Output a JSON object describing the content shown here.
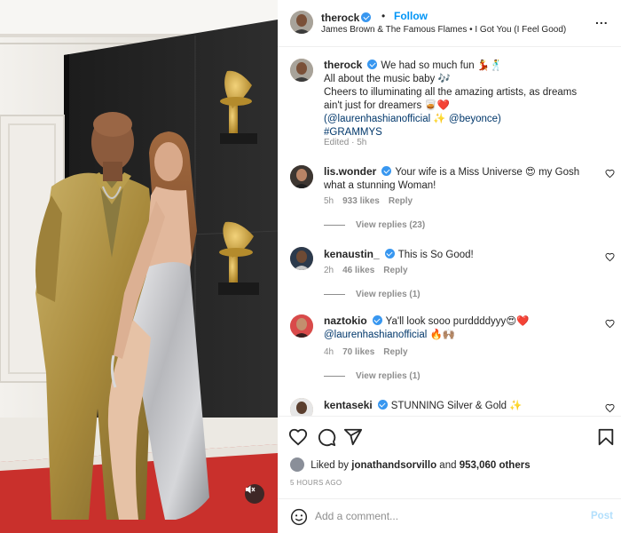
{
  "post": {
    "author": "therock",
    "follow_label": "Follow",
    "separator": "•",
    "audio": "James Brown & The Famous Flames • I Got You (I Feel Good)",
    "more_label": "...",
    "caption": {
      "line1": "We had so much fun 💃🕺",
      "line2": "All about the music baby 🎶",
      "line3": "Cheers to illuminating all the amazing artists, as dreams ain't just for dreamers 🥃❤️",
      "mention_open": "(",
      "mention1": "@laurenhashianofficial",
      "sparkle": " ✨ ",
      "mention2": "@beyonce",
      "mention_close": ")",
      "hashtag": "#GRAMMYS",
      "meta": "Edited · 5h"
    }
  },
  "comments": [
    {
      "user": "lis.wonder",
      "text": "Your wife is a Miss Universe 😍 my Gosh what a stunning Woman!",
      "time": "5h",
      "likes": "933 likes",
      "reply": "Reply",
      "view_replies": "View replies (23)"
    },
    {
      "user": "kenaustin_",
      "text": "This is So Good!",
      "time": "2h",
      "likes": "46 likes",
      "reply": "Reply",
      "view_replies": "View replies (1)"
    },
    {
      "user": "naztokio",
      "text": "Ya'll look sooo purddddyyy😍❤️",
      "mention": "@laurenhashianofficial",
      "text2": " 🔥🙌🏽",
      "time": "4h",
      "likes": "70 likes",
      "reply": "Reply",
      "view_replies": "View replies (1)"
    },
    {
      "user": "kentaseki",
      "text": "STUNNING Silver & Gold ✨"
    }
  ],
  "likes": {
    "prefix": "Liked by",
    "user": "jonathandsorvillo",
    "and": "and",
    "count": "953,060 others"
  },
  "timestamp": "5 HOURS AGO",
  "add_comment": {
    "placeholder": "Add a comment...",
    "post_label": "Post"
  },
  "colors": {
    "accent": "#0095f6",
    "verified": "#3897f0",
    "muted": "#8e8e8e"
  },
  "icons": [
    "more-icon",
    "heart-icon",
    "comment-icon",
    "share-icon",
    "bookmark-icon",
    "emoji-icon",
    "mute-icon",
    "verified-icon"
  ]
}
